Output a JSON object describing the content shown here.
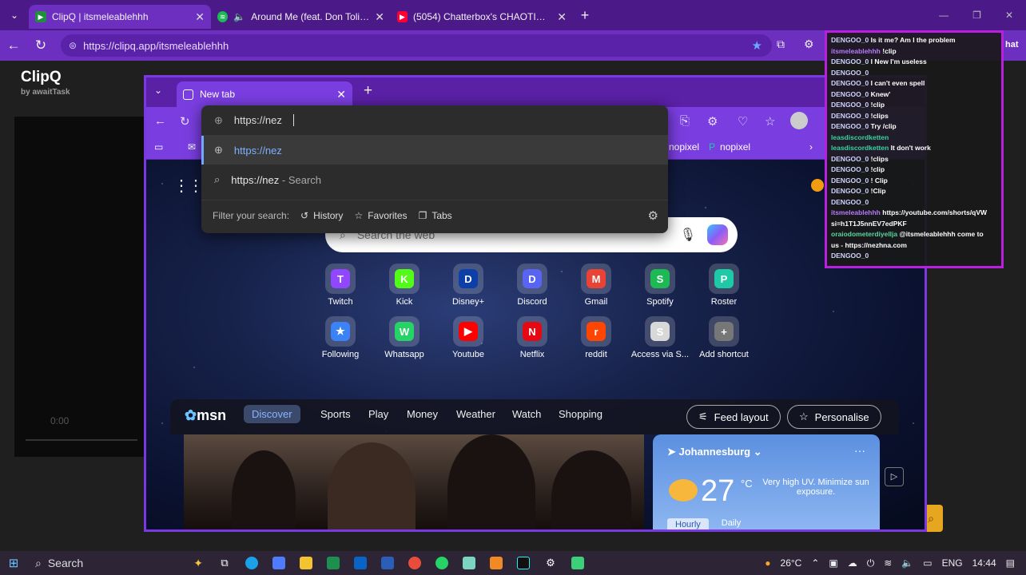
{
  "outer_tabs": [
    {
      "label": "ClipQ | itsmeleablehhh",
      "icon_color": "#20b04b"
    },
    {
      "label": "Around Me (feat. Don Toliver)",
      "icon_color": "#1db954"
    },
    {
      "label": "(5054) Chatterbox's CHAOTIC Day",
      "icon_color": "#ff0033"
    }
  ],
  "outer_url": "https://clipq.app/itsmeleablehhh",
  "outer_right_fragment": "hat",
  "clipq": {
    "logo": "ClipQ",
    "sub": "by awaitTask",
    "video_time": "0:00"
  },
  "inner": {
    "tab_label": "New tab",
    "favs": [
      {
        "label": "nopixel"
      },
      {
        "label": "nopixel"
      }
    ]
  },
  "omnibox": {
    "typed": "https://nez",
    "suggestions": [
      {
        "icon": "globe-icon",
        "text": "https://nez",
        "suffix": ""
      },
      {
        "icon": "search-icon",
        "text": "https://nez",
        "suffix": " - Search"
      }
    ],
    "filter_label": "Filter your search:",
    "filters": [
      "History",
      "Favorites",
      "Tabs"
    ]
  },
  "ntp": {
    "search_placeholder": "Search the web",
    "shortcuts_row1": [
      {
        "label": "Twitch",
        "color": "#9146ff",
        "glyph": "T"
      },
      {
        "label": "Kick",
        "color": "#53fc18",
        "glyph": "K"
      },
      {
        "label": "Disney+",
        "color": "#0d3fa8",
        "glyph": "D"
      },
      {
        "label": "Discord",
        "color": "#5865f2",
        "glyph": "D"
      },
      {
        "label": "Gmail",
        "color": "#ea4335",
        "glyph": "M"
      },
      {
        "label": "Spotify",
        "color": "#1db954",
        "glyph": "S"
      },
      {
        "label": "Roster",
        "color": "#1ec9a7",
        "glyph": "P"
      }
    ],
    "shortcuts_row2": [
      {
        "label": "Following",
        "color": "#3b82f6",
        "glyph": "★"
      },
      {
        "label": "Whatsapp",
        "color": "#25d366",
        "glyph": "W"
      },
      {
        "label": "Youtube",
        "color": "#ff0000",
        "glyph": "▶"
      },
      {
        "label": "Netflix",
        "color": "#e50914",
        "glyph": "N"
      },
      {
        "label": "reddit",
        "color": "#ff4500",
        "glyph": "r"
      },
      {
        "label": "Access via S...",
        "color": "#d8d8d8",
        "glyph": "S"
      },
      {
        "label": "Add shortcut",
        "color": "#777777",
        "glyph": "+"
      }
    ]
  },
  "msn": {
    "logo": "msn",
    "nav": [
      "Discover",
      "Sports",
      "Play",
      "Money",
      "Weather",
      "Watch",
      "Shopping"
    ],
    "feed_layout": "Feed layout",
    "personalise": "Personalise",
    "weather": {
      "city": "Johannesburg",
      "temp": "27",
      "unit": "°C",
      "uv": "Very high UV. Minimize sun exposure.",
      "tabs": [
        "Hourly",
        "Daily"
      ]
    }
  },
  "chat": [
    {
      "user": "DENGOO_0",
      "msg": "Is it me? Am I the problem",
      "cls": "u1"
    },
    {
      "user": "itsmeleablehhh",
      "msg": "!clip",
      "cls": "u2"
    },
    {
      "user": "DENGOO_0",
      "msg": "I New I'm useless",
      "cls": "u1"
    },
    {
      "user": "DENGOO_0",
      "msg": "",
      "cls": "u1"
    },
    {
      "user": "DENGOO_0",
      "msg": "I can't even spell",
      "cls": "u1"
    },
    {
      "user": "DENGOO_0",
      "msg": "Knew'",
      "cls": "u1"
    },
    {
      "user": "DENGOO_0",
      "msg": "!clip",
      "cls": "u1"
    },
    {
      "user": "DENGOO_0",
      "msg": "!clips",
      "cls": "u1"
    },
    {
      "user": "DENGOO_0",
      "msg": "Try /clip",
      "cls": "u1"
    },
    {
      "user": "leasdiscordketten",
      "msg": "",
      "cls": "u3"
    },
    {
      "user": "leasdiscordketten",
      "msg": "It don't work",
      "cls": "u3"
    },
    {
      "user": "DENGOO_0",
      "msg": "!clips",
      "cls": "u1"
    },
    {
      "user": "DENGOO_0",
      "msg": "!clip",
      "cls": "u1"
    },
    {
      "user": "DENGOO_0",
      "msg": "! Clip",
      "cls": "u1"
    },
    {
      "user": "DENGOO_0",
      "msg": "!Clip",
      "cls": "u1"
    },
    {
      "user": "DENGOO_0",
      "msg": "",
      "cls": "u1"
    },
    {
      "user": "itsmeleablehhh",
      "msg": "https://youtube.com/shorts/qVW",
      "cls": "u2"
    },
    {
      "user": "",
      "msg": "si=h1T1J5nnEV7edPKF",
      "cls": "msg"
    },
    {
      "user": "oraiodometerdiyellja",
      "msg": "@itsmeleablehhh come to",
      "cls": "u5"
    },
    {
      "user": "",
      "msg": "us - https://nezhna.com",
      "cls": "msg"
    },
    {
      "user": "",
      "msg": "",
      "cls": "msg"
    },
    {
      "user": "DENGOO_0",
      "msg": "",
      "cls": "u1"
    }
  ],
  "taskbar": {
    "search": "Search",
    "weather": "26°C",
    "lang": "ENG",
    "time": "14:44"
  }
}
